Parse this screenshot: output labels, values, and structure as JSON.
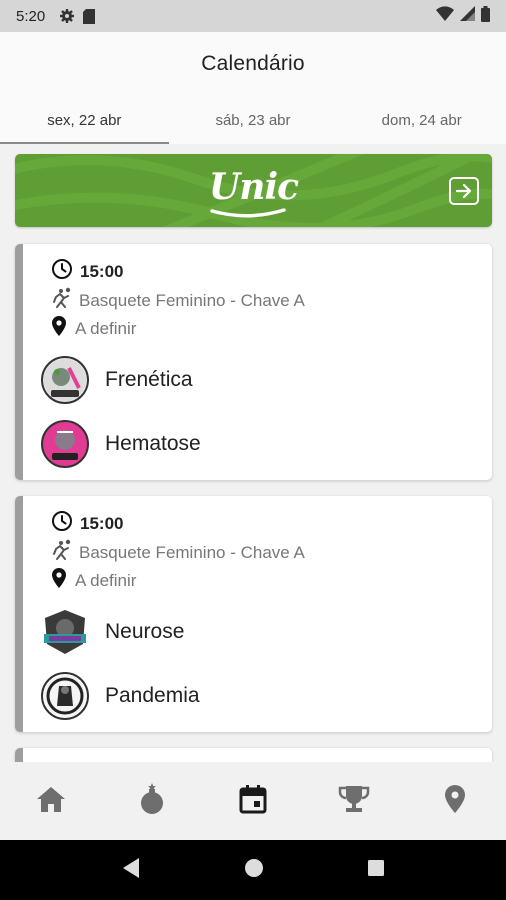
{
  "status_bar": {
    "time": "5:20",
    "icons": [
      "settings-gear-icon",
      "sd-card-icon",
      "wifi-icon",
      "signal-icon",
      "battery-icon"
    ]
  },
  "header": {
    "title": "Calendário",
    "tabs": [
      {
        "label": "sex, 22 abr",
        "active": true
      },
      {
        "label": "sáb, 23 abr",
        "active": false
      },
      {
        "label": "dom, 24 abr",
        "active": false
      }
    ]
  },
  "banner": {
    "logo_text": "Unic",
    "background_color": "#5e9e34",
    "action_icon": "arrow-right-box-icon"
  },
  "matches": [
    {
      "time": "15:00",
      "sport": "Basquete Feminino - Chave A",
      "location": "A definir",
      "teams": [
        {
          "name": "Frenética",
          "crest_icon": "team-crest-frenetica"
        },
        {
          "name": "Hematose",
          "crest_icon": "team-crest-hematose"
        }
      ]
    },
    {
      "time": "15:00",
      "sport": "Basquete Feminino - Chave A",
      "location": "A definir",
      "teams": [
        {
          "name": "Neurose",
          "crest_icon": "team-crest-neurose"
        },
        {
          "name": "Pandemia",
          "crest_icon": "team-crest-pandemia"
        }
      ]
    }
  ],
  "bottom_nav": [
    {
      "icon": "home-icon",
      "active": false
    },
    {
      "icon": "bomb-icon",
      "active": false
    },
    {
      "icon": "calendar-icon",
      "active": true
    },
    {
      "icon": "trophy-icon",
      "active": false
    },
    {
      "icon": "location-pin-icon",
      "active": false
    }
  ],
  "system_nav": [
    "back-icon",
    "home-circle-icon",
    "recents-icon"
  ]
}
